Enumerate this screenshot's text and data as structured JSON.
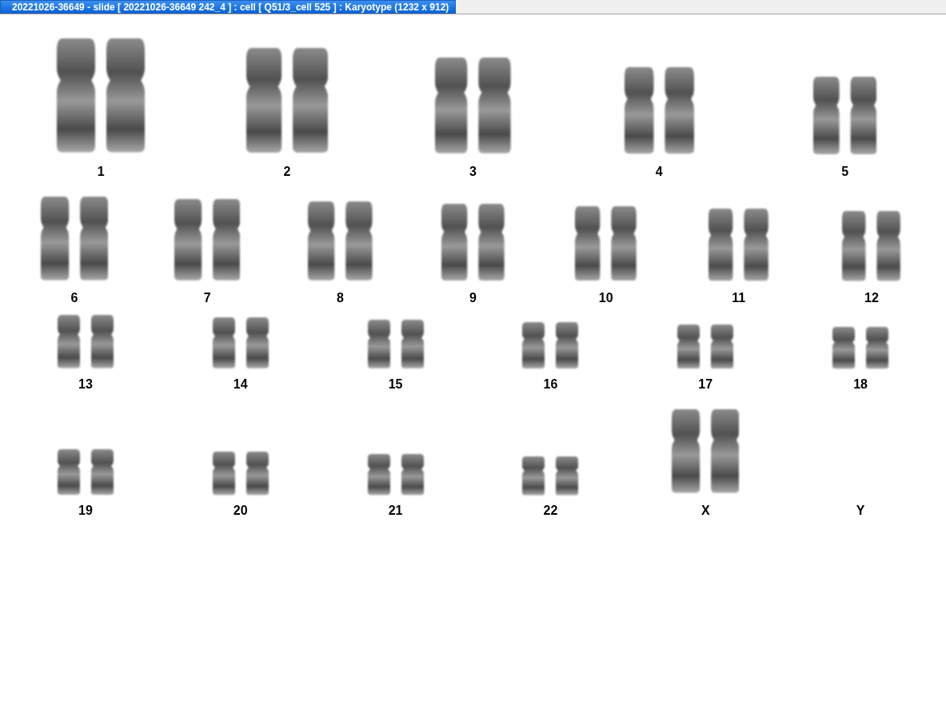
{
  "window": {
    "title": "20221026-36649 - slide [ 20221026-36649 242_4 ] : cell [ Q51/3_cell 525 ] : Karyotype  (1232 x 912)"
  },
  "rows": [
    {
      "chromosomes": [
        {
          "label": "1",
          "present": true
        },
        {
          "label": "2",
          "present": true
        },
        {
          "label": "3",
          "present": true
        },
        {
          "label": "4",
          "present": true
        },
        {
          "label": "5",
          "present": true
        }
      ]
    },
    {
      "chromosomes": [
        {
          "label": "6",
          "present": true
        },
        {
          "label": "7",
          "present": true
        },
        {
          "label": "8",
          "present": true
        },
        {
          "label": "9",
          "present": true
        },
        {
          "label": "10",
          "present": true
        },
        {
          "label": "11",
          "present": true
        },
        {
          "label": "12",
          "present": true
        }
      ]
    },
    {
      "chromosomes": [
        {
          "label": "13",
          "present": true
        },
        {
          "label": "14",
          "present": true
        },
        {
          "label": "15",
          "present": true
        },
        {
          "label": "16",
          "present": true
        },
        {
          "label": "17",
          "present": true
        },
        {
          "label": "18",
          "present": true
        }
      ]
    },
    {
      "chromosomes": [
        {
          "label": "19",
          "present": true
        },
        {
          "label": "20",
          "present": true
        },
        {
          "label": "21",
          "present": true
        },
        {
          "label": "22",
          "present": true
        },
        {
          "label": "X",
          "present": true
        },
        {
          "label": "Y",
          "present": false
        }
      ]
    }
  ]
}
